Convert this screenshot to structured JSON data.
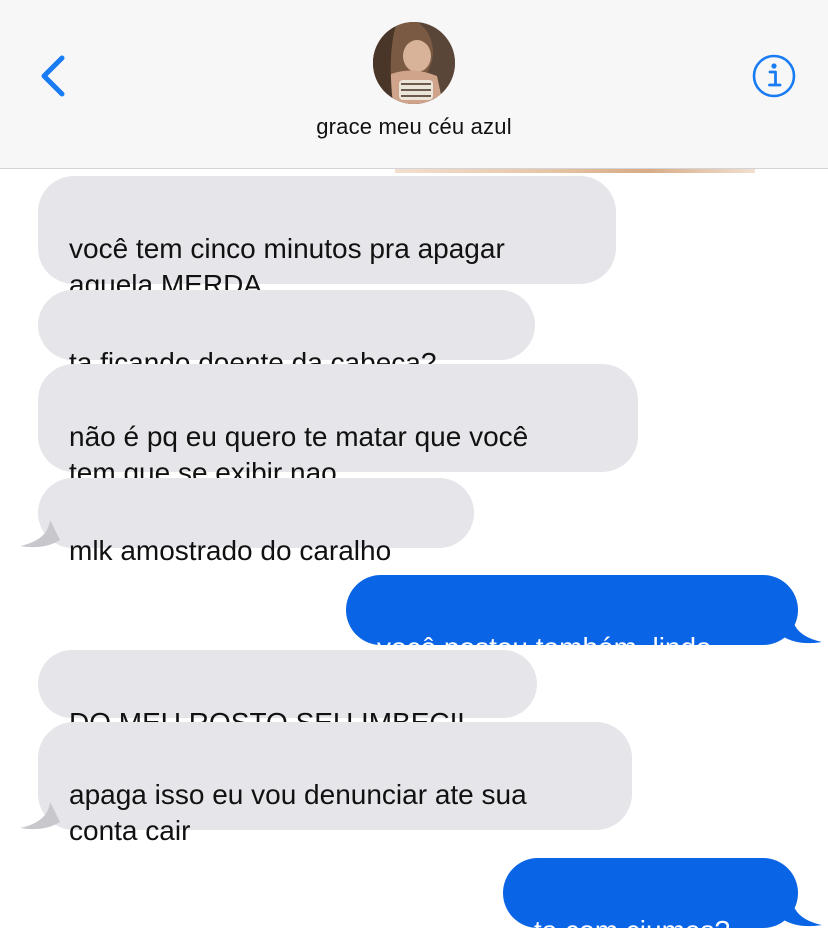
{
  "header": {
    "contact_name": "grace meu céu azul",
    "back_icon": "chevron-left-icon",
    "info_icon": "info-icon",
    "accent_color": "#1a7cf5",
    "header_bg": "#f7f7f7"
  },
  "colors": {
    "incoming_bubble": "#e5e5ea",
    "outgoing_bubble": "#0a64e6",
    "incoming_text": "#111111",
    "outgoing_text": "#ffffff"
  },
  "messages": [
    {
      "direction": "incoming",
      "text": "você tem cinco minutos pra apagar\naquela MERDA"
    },
    {
      "direction": "incoming",
      "text": "ta ficando doente da cabeça?"
    },
    {
      "direction": "incoming",
      "text": "não é pq eu quero te matar que você\ntem que se exibir nao"
    },
    {
      "direction": "incoming",
      "text": "mlk amostrado do caralho"
    },
    {
      "direction": "outgoing",
      "text": "você postou também, linda"
    },
    {
      "direction": "incoming",
      "text": "DO MEU ROSTO SEU IMBECIL"
    },
    {
      "direction": "incoming",
      "text": "apaga isso eu vou denunciar ate sua\nconta cair"
    },
    {
      "direction": "outgoing",
      "text": "ta com ciumes?"
    }
  ]
}
